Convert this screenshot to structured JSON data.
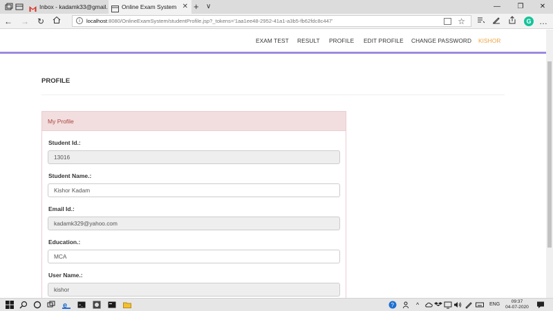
{
  "browser": {
    "tabs": [
      {
        "label": "Inbox - kadamk33@gmail.c",
        "icon": "gmail-icon"
      },
      {
        "label": "Online Exam System",
        "icon": "page-icon"
      }
    ],
    "new_tab": "+",
    "tab_menu": "∨",
    "window_controls": {
      "minimize": "—",
      "maximize": "❐",
      "close": "✕"
    },
    "url_host": "localhost",
    "url_rest": ":8080/OnlineExamSystem/studentProfile.jsp?_tokens='1aa1ee48-2952-41a1-a3b5-fb62fdc8c447'",
    "grammarly_letter": "G"
  },
  "nav": {
    "links": [
      "EXAM TEST",
      "RESULT",
      "PROFILE",
      "EDIT PROFILE",
      "CHANGE PASSWORD"
    ],
    "user": "KISHOR",
    "accent_color": "#9b8ae0",
    "user_color": "#f0a23c"
  },
  "page": {
    "title": "PROFILE",
    "panel_title": "My Profile",
    "fields": [
      {
        "label": "Student Id.:",
        "value": "13016",
        "readonly": true
      },
      {
        "label": "Student Name.:",
        "value": "Kishor Kadam",
        "readonly": false
      },
      {
        "label": "Email Id.:",
        "value": "kadamk329@yahoo.com",
        "readonly": true
      },
      {
        "label": "Education.:",
        "value": "MCA",
        "readonly": false
      },
      {
        "label": "User Name.:",
        "value": "kishor",
        "readonly": true
      }
    ]
  },
  "taskbar": {
    "language": "ENG",
    "time": "09:37",
    "date": "04-07-2020"
  }
}
